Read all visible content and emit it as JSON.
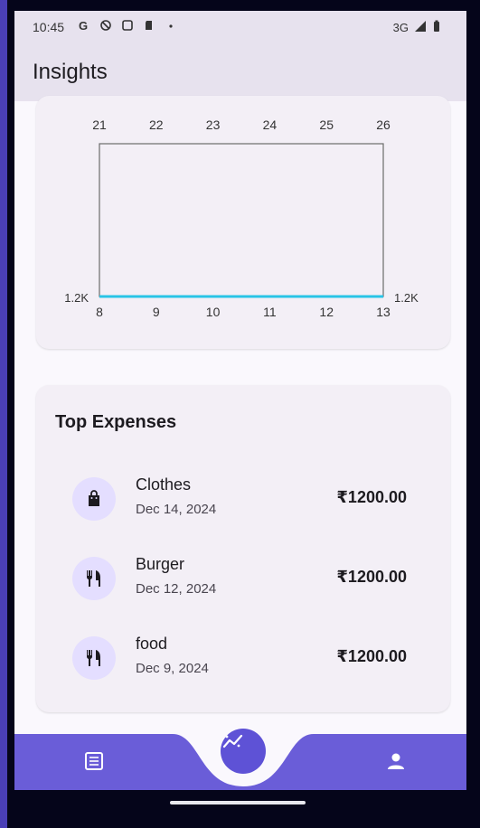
{
  "status_bar": {
    "time": "10:45",
    "network": "3G",
    "icons": [
      "google-icon",
      "shield-icon",
      "copy-icon",
      "sim-icon",
      "dot-icon"
    ]
  },
  "app_bar": {
    "title": "Insights"
  },
  "chart_data": {
    "type": "line",
    "title": "",
    "x_top": [
      "21",
      "22",
      "23",
      "24",
      "25",
      "26"
    ],
    "x_bottom": [
      "8",
      "9",
      "10",
      "11",
      "12",
      "13"
    ],
    "y_left_label": "1.2K",
    "y_right_label": "1.2K",
    "series": [
      {
        "values": [
          1200,
          1200,
          1200,
          1200,
          1200,
          1200
        ]
      }
    ],
    "line_color": "#29c4e6"
  },
  "top_expenses": {
    "heading": "Top Expenses",
    "items": [
      {
        "name": "Clothes",
        "date": "Dec 14, 2024",
        "amount": "₹1200.00",
        "icon": "shopping-bag-icon"
      },
      {
        "name": "Burger",
        "date": "Dec 12, 2024",
        "amount": "₹1200.00",
        "icon": "restaurant-icon"
      },
      {
        "name": "food",
        "date": "Dec 9, 2024",
        "amount": "₹1200.00",
        "icon": "restaurant-icon"
      }
    ]
  },
  "bottom_nav": {
    "items": [
      "list-icon",
      "insights-icon",
      "person-icon"
    ],
    "accent": "#6a5dd8"
  }
}
